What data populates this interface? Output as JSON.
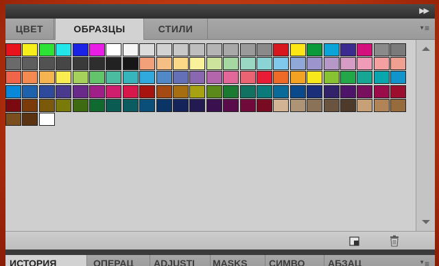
{
  "swatches_panel": {
    "tabs": [
      {
        "label": "ЦВЕТ",
        "active": false
      },
      {
        "label": "ОБРАЗЦЫ",
        "active": true
      },
      {
        "label": "СТИЛИ",
        "active": false
      }
    ],
    "menu_icon": "panel-menu-icon",
    "collapse_icon": "double-arrow-right-icon",
    "swatch_rows": [
      [
        "#e8121d",
        "#f7ef1a",
        "#2de235",
        "#22e6ea",
        "#1a22e8",
        "#e81ee6",
        "#ffffff",
        "#f5f5f5",
        "#dcdcdc",
        "#d2d2d2",
        "#c8c8c8",
        "#bebebe",
        "#b4b4b4",
        "#a8a8a8",
        "#9a9a9a",
        "#8a8a8a",
        "#d7161e",
        "#fde516",
        "#0a9a3a",
        "#0aa4d8",
        "#3b2a90",
        "#d4107c",
        "#8a8a8a",
        "#7a7a7a"
      ],
      [
        "#6a6a6a",
        "#5e5e5e",
        "#525252",
        "#464646",
        "#3a3a3a",
        "#2e2e2e",
        "#222222",
        "#161616",
        "#f2a07a",
        "#f4be84",
        "#fad888",
        "#faf29a",
        "#cde49c",
        "#a5d8a0",
        "#9ad8c4",
        "#8ad4d6",
        "#80c8ec",
        "#90a8d8",
        "#9c94cc",
        "#b698c8",
        "#d69cc6",
        "#f09cb8",
        "#f4a0a0",
        "#f0a090"
      ],
      [
        "#f0644a",
        "#f48a50",
        "#f6b450",
        "#f8ec50",
        "#a6d25c",
        "#64c46c",
        "#4cbca0",
        "#36b6bc",
        "#30aade",
        "#5088c8",
        "#6470b8",
        "#8a68b0",
        "#b466ac",
        "#e2689a",
        "#ec6474",
        "#e81c34",
        "#ee6a26",
        "#f4a222",
        "#f6e81a",
        "#86c232",
        "#22a848",
        "#16a694",
        "#0aa6ae",
        "#1094cc"
      ],
      [
        "#0888d8",
        "#1e62ae",
        "#2e4a9c",
        "#4a3a8e",
        "#6a2a8a",
        "#a01e88",
        "#d01e6e",
        "#d8174a",
        "#a81410",
        "#a44a12",
        "#a66e10",
        "#a6a212",
        "#5c8a1a",
        "#1a7a32",
        "#127262",
        "#0a7a7a",
        "#0a6a9a",
        "#0a4a8a",
        "#1a2e7a",
        "#32226a",
        "#4e146a",
        "#78105e",
        "#9a0c4a",
        "#9c0e2e"
      ],
      [
        "#7a0a10",
        "#7a3a0a",
        "#7a5a0a",
        "#7a7a0a",
        "#3e6a12",
        "#106a30",
        "#0a5c52",
        "#0a5c60",
        "#0a4e7a",
        "#0a3466",
        "#14245a",
        "#241a52",
        "#3a104e",
        "#5a0c4a",
        "#700a3a",
        "#780a22",
        "#d2b494",
        "#ae9476",
        "#8a7258",
        "#6a5440",
        "#4e3a2a",
        "#c8a078",
        "#b08456",
        "#966c3c"
      ],
      [
        "#7a4e1e",
        "#5a3412",
        "#ffffff"
      ]
    ],
    "buttons": [
      {
        "icon": "new-swatch-icon"
      },
      {
        "icon": "trash-icon"
      }
    ]
  },
  "bottom_panel": {
    "tabs": [
      {
        "label": "ИСТОРИЯ",
        "active": true
      },
      {
        "label": "ОПЕРАЦ",
        "active": false
      },
      {
        "label": "ADJUSTI",
        "active": false
      },
      {
        "label": "MASKS",
        "active": false
      },
      {
        "label": "СИМВО",
        "active": false
      },
      {
        "label": "АБЗАЦ",
        "active": false
      }
    ],
    "menu_icon": "panel-menu-icon"
  }
}
